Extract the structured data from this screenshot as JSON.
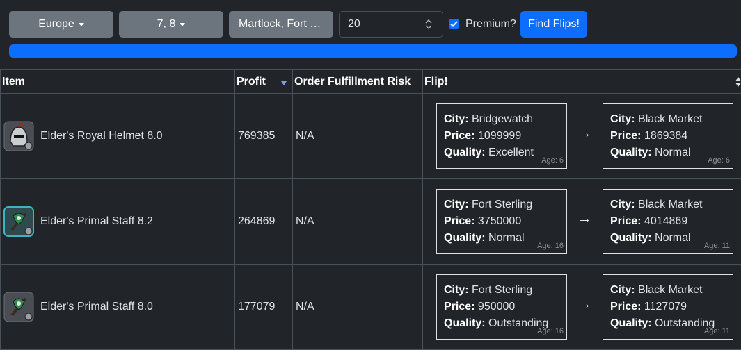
{
  "toolbar": {
    "region": "Europe",
    "tiers": "7, 8",
    "cities": "Martlock, Fort Sterling, Bridgewatch, Black Market",
    "count_value": "20",
    "premium_label": "Premium?",
    "premium_checked": true,
    "find_label": "Find Flips!",
    "progress_percent": 100
  },
  "table": {
    "headers": [
      "Item",
      "Profit",
      "Order Fulfillment Risk",
      "Flip!"
    ],
    "labels": {
      "city": "City:",
      "price": "Price:",
      "quality": "Quality:",
      "arrow": "→"
    },
    "rows": [
      {
        "item": "Elder's Royal Helmet 8.0",
        "icon": "helmet-icon",
        "profit": "769385",
        "risk": "N/A",
        "from": {
          "city": "Bridgewatch",
          "price": "1099999",
          "quality": "Excellent",
          "age": "Age: 6"
        },
        "to": {
          "city": "Black Market",
          "price": "1869384",
          "quality": "Normal",
          "age": "Age: 6"
        }
      },
      {
        "item": "Elder's Primal Staff 8.2",
        "icon": "staff-icon",
        "profit": "264869",
        "risk": "N/A",
        "from": {
          "city": "Fort Sterling",
          "price": "3750000",
          "quality": "Normal",
          "age": "Age: 16"
        },
        "to": {
          "city": "Black Market",
          "price": "4014869",
          "quality": "Normal",
          "age": "Age: 11"
        }
      },
      {
        "item": "Elder's Primal Staff 8.0",
        "icon": "staff-icon",
        "profit": "177079",
        "risk": "N/A",
        "from": {
          "city": "Fort Sterling",
          "price": "950000",
          "quality": "Outstanding",
          "age": "Age: 16"
        },
        "to": {
          "city": "Black Market",
          "price": "1127079",
          "quality": "Outstanding",
          "age": "Age: 11"
        }
      }
    ]
  },
  "colors": {
    "background": "#212529",
    "primary": "#0d6efd",
    "secondary": "#6c757d",
    "border": "#495057"
  }
}
